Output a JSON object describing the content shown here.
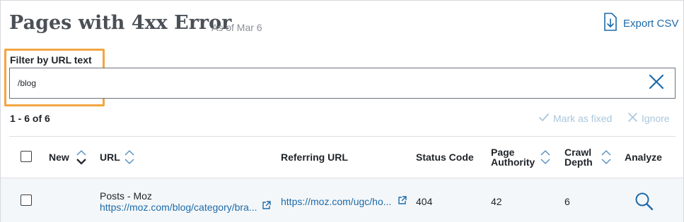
{
  "header": {
    "title": "Pages with 4xx Error",
    "as_of": "As of Mar 6",
    "export_label": "Export CSV"
  },
  "filter": {
    "label": "Filter by URL text",
    "value": "/blog"
  },
  "results": {
    "count_text": "1 - 6 of 6",
    "mark_fixed_label": "Mark as fixed",
    "ignore_label": "Ignore"
  },
  "table": {
    "columns": {
      "new": "New",
      "url": "URL",
      "referring_url": "Referring URL",
      "status_code": "Status Code",
      "page_authority_1": "Page",
      "page_authority_2": "Authority",
      "crawl_depth_1": "Crawl",
      "crawl_depth_2": "Depth",
      "analyze": "Analyze"
    },
    "rows": [
      {
        "page_title": "Posts - Moz",
        "url": "https://moz.com/blog/category/bra...",
        "referring_url": "https://moz.com/ugc/ho...",
        "status_code": "404",
        "page_authority": "42",
        "crawl_depth": "6"
      }
    ]
  },
  "colors": {
    "accent": "#1c6aa9",
    "highlight": "#f2a541",
    "disabled_action": "#a9c7dd",
    "row_background": "#f4f7f9"
  },
  "icons": {
    "export": "download-file-icon",
    "clear": "close-icon",
    "mark_fixed": "checkmark-icon",
    "ignore": "close-icon",
    "sort": "sort-icon",
    "external": "external-link-icon",
    "analyze": "search-icon"
  }
}
